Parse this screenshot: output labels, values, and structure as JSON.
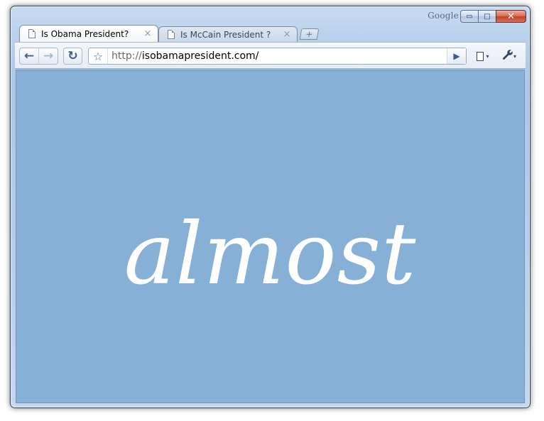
{
  "window": {
    "brand_label": "Google",
    "controls": {
      "minimize": "▭",
      "maximize": "□",
      "close": "✕"
    }
  },
  "tabs": [
    {
      "title": "Is Obama President?",
      "active": true,
      "close_glyph": "×"
    },
    {
      "title": "Is McCain President ?",
      "active": false,
      "close_glyph": "×"
    }
  ],
  "new_tab": {
    "glyph": "+"
  },
  "toolbar": {
    "back_glyph": "←",
    "forward_glyph": "→",
    "reload_glyph": "↻",
    "star_glyph": "☆",
    "go_glyph": "▶",
    "wrench_glyph": "🔧",
    "caret_glyph": "▾"
  },
  "address_bar": {
    "scheme": "http://",
    "host_path": "isobamapresident.com/"
  },
  "page": {
    "background_color": "#87b0d6",
    "headline": "almost",
    "headline_color": "#ffffff"
  }
}
